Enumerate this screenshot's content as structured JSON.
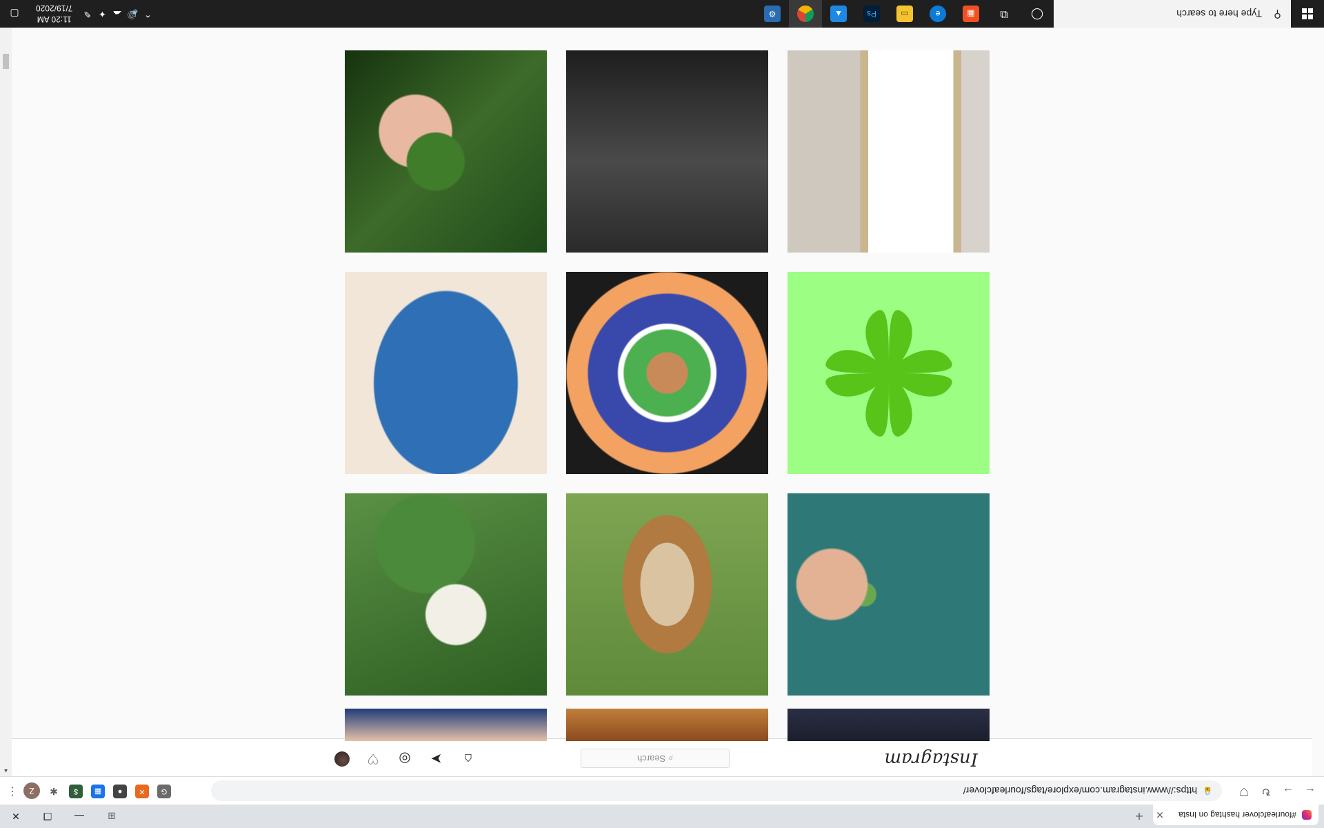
{
  "browser": {
    "tab_title": "#fourleafclover hashtag on Insta",
    "url": "https://www.instagram.com/explore/tags/fourleafclover/",
    "profile_initial": "Z"
  },
  "instagram": {
    "logo_text": "Instagram",
    "search_placeholder": "Search"
  },
  "taskbar": {
    "search_placeholder": "Type here to search",
    "time": "11:20 AM",
    "date": "7/19/2020",
    "apps": [
      "task-view",
      "chrome",
      "photos",
      "photoshop",
      "file-explorer",
      "edge",
      "store",
      "cortana"
    ]
  },
  "grid": {
    "posts": [
      {
        "row": "top-partial",
        "subject": "dark"
      },
      {
        "row": "top-partial",
        "subject": "rug"
      },
      {
        "row": "top-partial",
        "subject": "stripe"
      },
      {
        "subject": "clover in hand"
      },
      {
        "subject": "dog on grass"
      },
      {
        "subject": "white clover flower"
      },
      {
        "subject": "clover on teal"
      },
      {
        "subject": "green shamrock"
      },
      {
        "subject": "colorful artwork"
      },
      {
        "subject": "blue fabric"
      },
      {
        "subject": "black fabric"
      },
      {
        "subject": "mirror selfie"
      }
    ]
  }
}
